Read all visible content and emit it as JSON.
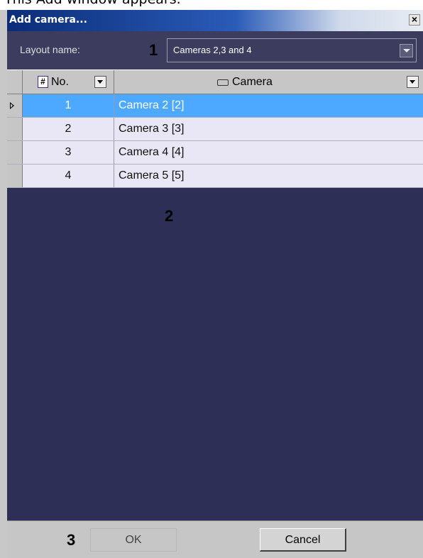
{
  "page_caption": "This Add window appears.",
  "dialog": {
    "title": "Add camera...",
    "close_label": "×"
  },
  "layout": {
    "label": "Layout name:",
    "value": "Cameras 2,3 and 4"
  },
  "annotations": [
    "1",
    "2",
    "3"
  ],
  "grid": {
    "columns": [
      {
        "label": "No.",
        "icon": "hash-icon"
      },
      {
        "label": "Camera",
        "icon": "camera-icon"
      }
    ],
    "rows": [
      {
        "no": "1",
        "camera": "Camera 2 [2]",
        "selected": true
      },
      {
        "no": "2",
        "camera": "Camera 3 [3]",
        "selected": false
      },
      {
        "no": "3",
        "camera": "Camera 4 [4]",
        "selected": false
      },
      {
        "no": "4",
        "camera": "Camera 5 [5]",
        "selected": false
      }
    ]
  },
  "buttons": {
    "ok": "OK",
    "cancel": "Cancel"
  },
  "colors": {
    "background_dark": "#2e2f57",
    "selection": "#4ca9ff",
    "row": "#e9e6f6"
  }
}
